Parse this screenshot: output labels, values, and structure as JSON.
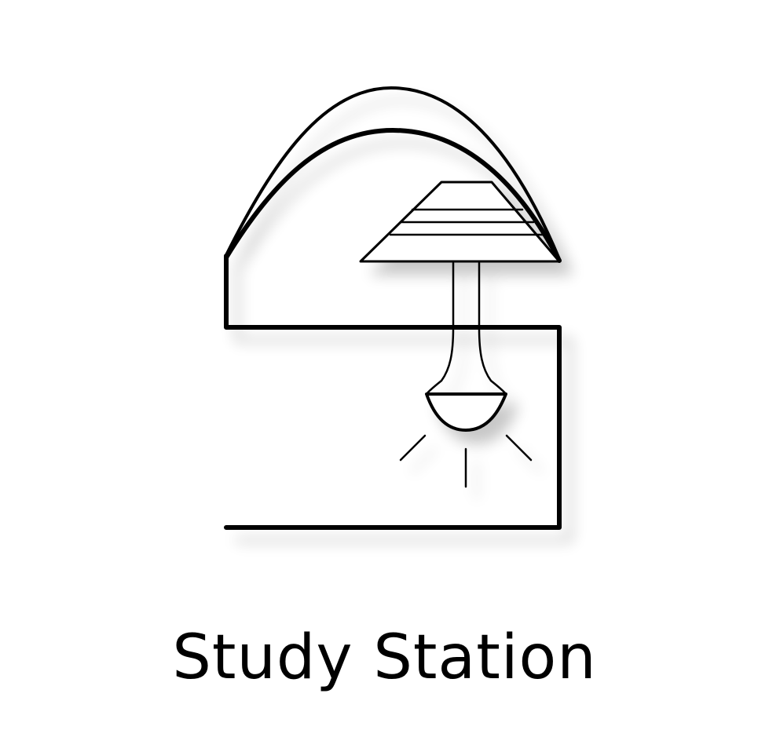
{
  "logo": {
    "name": "Study Station",
    "icon": "desk-lamp-icon",
    "stroke_color": "#000000",
    "background_color": "#ffffff"
  }
}
